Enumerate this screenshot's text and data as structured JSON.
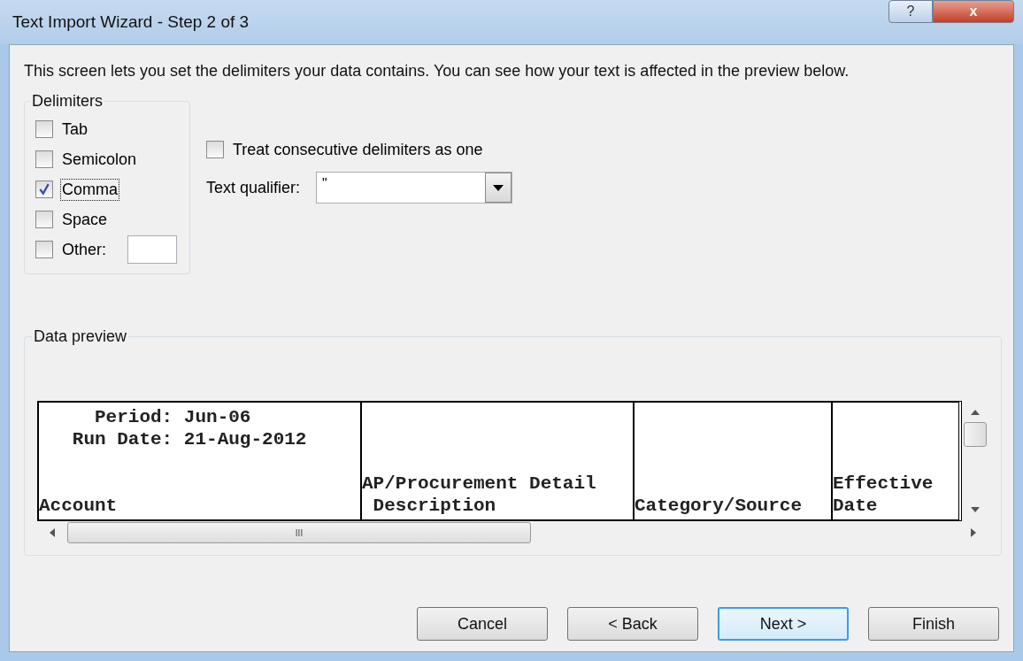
{
  "window": {
    "title": "Text Import Wizard - Step 2 of 3",
    "title_buttons": [
      "?",
      "x"
    ]
  },
  "intro": "This screen lets you set the delimiters your data contains.  You can see how your text is affected in the preview below.",
  "delimiters": {
    "legend": "Delimiters",
    "items": [
      {
        "label": "Tab",
        "checked": false,
        "focused": false
      },
      {
        "label": "Semicolon",
        "checked": false,
        "focused": false
      },
      {
        "label": "Comma",
        "checked": true,
        "focused": true
      },
      {
        "label": "Space",
        "checked": false,
        "focused": false
      },
      {
        "label": "Other:",
        "checked": false,
        "focused": false
      }
    ]
  },
  "consecutive": {
    "label": "Treat consecutive delimiters as one",
    "checked": false
  },
  "text_qualifier": {
    "label": "Text qualifier:",
    "value": "\""
  },
  "preview": {
    "legend": "Data preview",
    "columns": [
      "     Period: Jun-06\n   Run Date: 21-Aug-2012\n\n\nAccount",
      "\n\n\nAP/Procurement Detail\n Description",
      "\n\n\n\nCategory/Source",
      "\n\n\nEffective\nDate"
    ],
    "scroll_grip": "III"
  },
  "buttons": [
    {
      "label": "Cancel",
      "focused": false
    },
    {
      "label": "< Back",
      "focused": false
    },
    {
      "label": "Next >",
      "focused": true
    },
    {
      "label": "Finish",
      "focused": false
    }
  ]
}
